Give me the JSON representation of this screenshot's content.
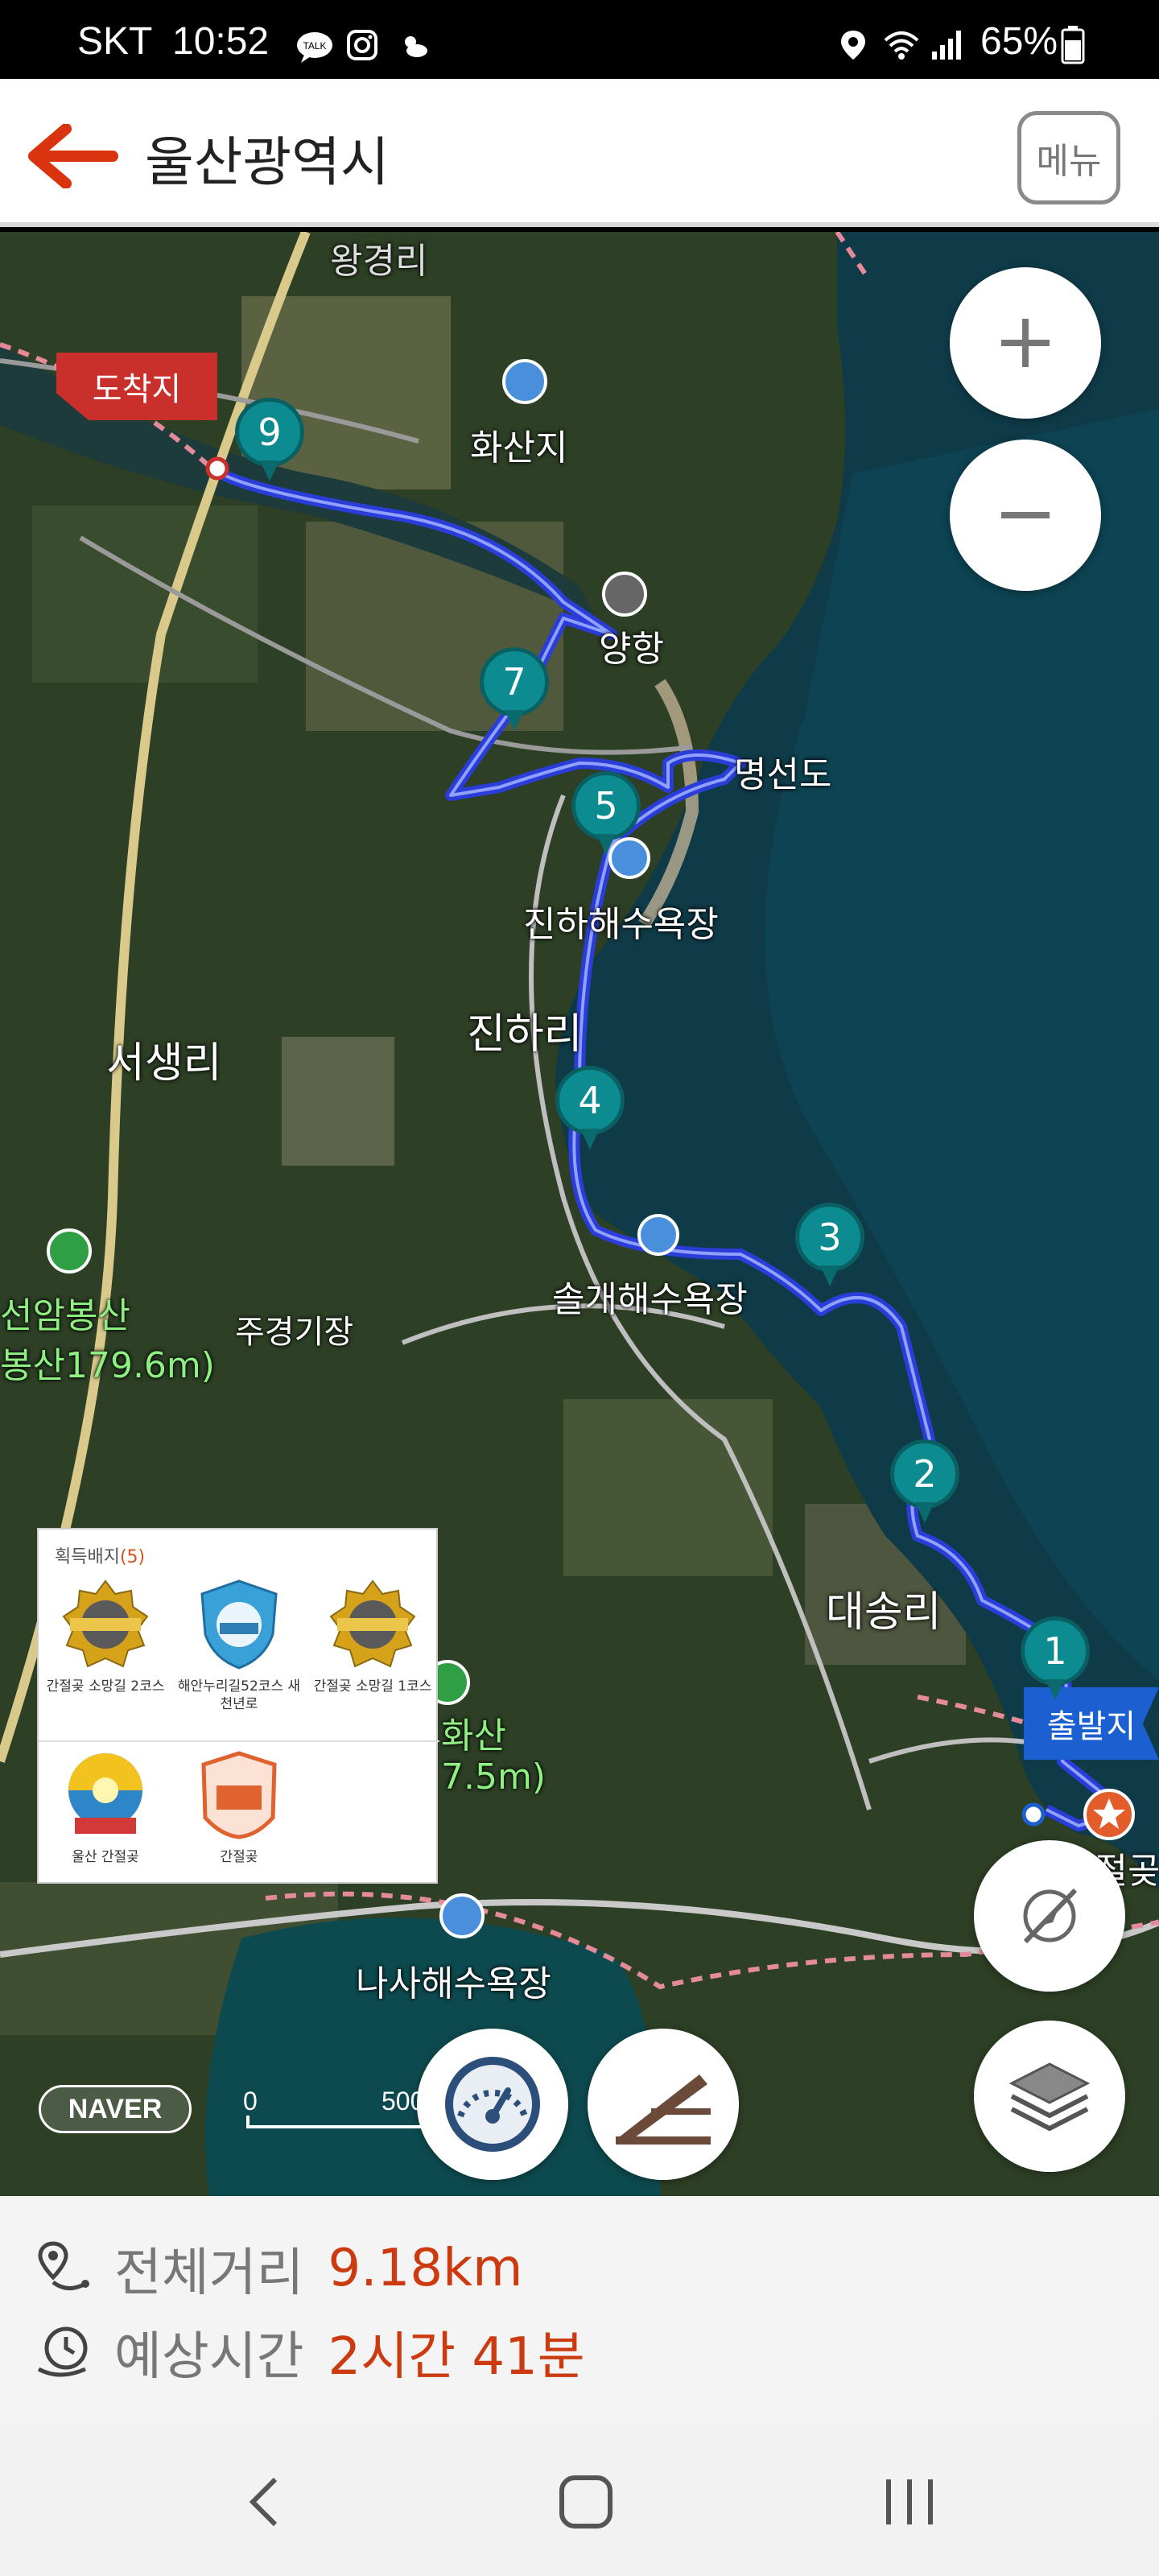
{
  "status_bar": {
    "carrier": "SKT",
    "time": "10:52",
    "battery": "65%",
    "icons": [
      "talk-icon",
      "instagram-icon",
      "weather-icon",
      "location-icon",
      "wifi-icon",
      "signal-icon",
      "battery-icon"
    ]
  },
  "header": {
    "title": "울산광역시",
    "menu_label": "메뉴",
    "back_color": "#d9340f"
  },
  "map": {
    "places": {
      "hwasanji": "화산지",
      "port": "양항",
      "myeongseondo": "명선도",
      "jinha_beach": "진하해수욕장",
      "jinhari": "진하리",
      "seosaengri": "서생리",
      "seonambong": "선암봉산",
      "seonambong_elev": "봉산179.6m)",
      "jugyeong": "주경기장",
      "solgae_beach": "솔개해수욕장",
      "daesongri": "대송리",
      "hwasan_mtn": "화산",
      "hwasan_elev": "7.5m)",
      "nasa_beach": "나사해수욕장",
      "ganjeolgot": "간절곶",
      "top_partial": "왕경리"
    },
    "flags": {
      "end": "도착지",
      "start": "출발지"
    },
    "waypoints": [
      "9",
      "7",
      "5",
      "4",
      "3",
      "2",
      "1"
    ],
    "attribution": "NAVER",
    "scale": {
      "start": "0",
      "end": "500m"
    },
    "route_color": "#2a3dd8"
  },
  "badges": {
    "title": "획득배지",
    "count": "(5)",
    "items": [
      {
        "label": "간절곶 소망길 2코스",
        "icon": "gold-badge-icon"
      },
      {
        "label": "해안누리길52코스 새천년로",
        "icon": "blue-shield-badge-icon"
      },
      {
        "label": "간절곶 소망길 1코스",
        "icon": "gold-badge-icon"
      },
      {
        "label": "울산 간절곶",
        "icon": "sunrise-badge-icon"
      },
      {
        "label": "간절곶",
        "icon": "orange-badge-icon"
      }
    ]
  },
  "info": {
    "distance_label": "전체거리",
    "distance_value": "9.18km",
    "time_label": "예상시간",
    "time_value": "2시간 41분"
  }
}
